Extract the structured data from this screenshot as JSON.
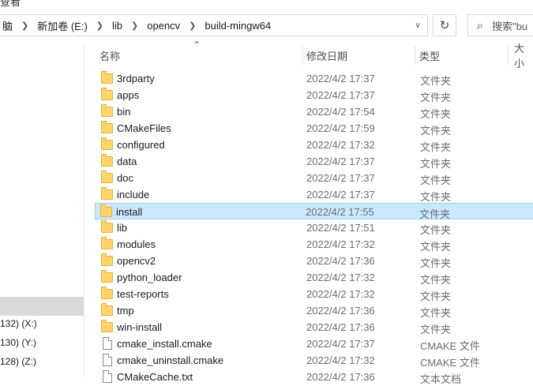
{
  "window": {
    "title_partial": "查看"
  },
  "address_bar": {
    "crumbs": [
      "脑",
      "新加卷 (E:)",
      "lib",
      "opencv",
      "build-mingw64"
    ]
  },
  "search": {
    "placeholder": "搜索\"bu"
  },
  "nav": {
    "drives": [
      "132) (X:)",
      "130) (Y:)",
      "128) (Z:)"
    ]
  },
  "columns": {
    "name": "名称",
    "date": "修改日期",
    "type": "类型",
    "size": "大小"
  },
  "files": [
    {
      "name": "3rdparty",
      "date": "2022/4/2 17:37",
      "type": "文件夹",
      "kind": "folder"
    },
    {
      "name": "apps",
      "date": "2022/4/2 17:37",
      "type": "文件夹",
      "kind": "folder"
    },
    {
      "name": "bin",
      "date": "2022/4/2 17:54",
      "type": "文件夹",
      "kind": "folder"
    },
    {
      "name": "CMakeFiles",
      "date": "2022/4/2 17:59",
      "type": "文件夹",
      "kind": "folder"
    },
    {
      "name": "configured",
      "date": "2022/4/2 17:32",
      "type": "文件夹",
      "kind": "folder"
    },
    {
      "name": "data",
      "date": "2022/4/2 17:37",
      "type": "文件夹",
      "kind": "folder"
    },
    {
      "name": "doc",
      "date": "2022/4/2 17:37",
      "type": "文件夹",
      "kind": "folder"
    },
    {
      "name": "include",
      "date": "2022/4/2 17:37",
      "type": "文件夹",
      "kind": "folder"
    },
    {
      "name": "install",
      "date": "2022/4/2 17:55",
      "type": "文件夹",
      "kind": "folder",
      "selected": true
    },
    {
      "name": "lib",
      "date": "2022/4/2 17:51",
      "type": "文件夹",
      "kind": "folder"
    },
    {
      "name": "modules",
      "date": "2022/4/2 17:32",
      "type": "文件夹",
      "kind": "folder"
    },
    {
      "name": "opencv2",
      "date": "2022/4/2 17:36",
      "type": "文件夹",
      "kind": "folder"
    },
    {
      "name": "python_loader",
      "date": "2022/4/2 17:32",
      "type": "文件夹",
      "kind": "folder"
    },
    {
      "name": "test-reports",
      "date": "2022/4/2 17:32",
      "type": "文件夹",
      "kind": "folder"
    },
    {
      "name": "tmp",
      "date": "2022/4/2 17:36",
      "type": "文件夹",
      "kind": "folder"
    },
    {
      "name": "win-install",
      "date": "2022/4/2 17:36",
      "type": "文件夹",
      "kind": "folder"
    },
    {
      "name": "cmake_install.cmake",
      "date": "2022/4/2 17:37",
      "type": "CMAKE 文件",
      "kind": "file"
    },
    {
      "name": "cmake_uninstall.cmake",
      "date": "2022/4/2 17:32",
      "type": "CMAKE 文件",
      "kind": "file"
    },
    {
      "name": "CMakeCache.txt",
      "date": "2022/4/2 17:36",
      "type": "文本文档",
      "kind": "file"
    }
  ]
}
